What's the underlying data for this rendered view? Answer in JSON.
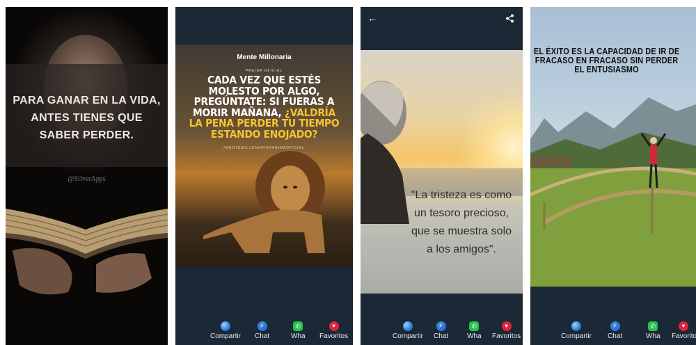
{
  "panels": [
    {
      "quote": "PARA GANAR EN LA VIDA, ANTES TIENES QUE SABER PERDER.",
      "watermark": "@SilverApps"
    },
    {
      "brand": "Mente Millonaria",
      "brand_sub": "PAGINA OFICIAL",
      "quote_main": "CADA VEZ QUE ESTÉS MOLESTO POR ALGO, PREGÚNTATE: SI FUERAS A MORIR MAÑANA, ",
      "quote_highlight": "¿VALDRÍA LA PENA PERDER TU TIEMPO ESTANDO ENOJADO?",
      "handle": "/MENTEMILLONARIAPAGINAOFICIAL"
    },
    {
      "quote": "\"La tristeza es como un tesoro precioso, que se muestra solo a los amigos\"."
    },
    {
      "quote": "EL ÉXITO ES LA CAPACIDAD DE IR DE FRACASO EN FRACASO SIN PERDER EL ENTUSIASMO"
    }
  ],
  "actions": {
    "share": "Compartir",
    "chat": "Chat",
    "wha": "Wha",
    "fav": "Favoritos"
  },
  "colors": {
    "app_bg": "#1b2836",
    "highlight": "#f4c430",
    "fav": "#e0243b",
    "whatsapp": "#25c24d",
    "messenger": "#2f8cff"
  }
}
